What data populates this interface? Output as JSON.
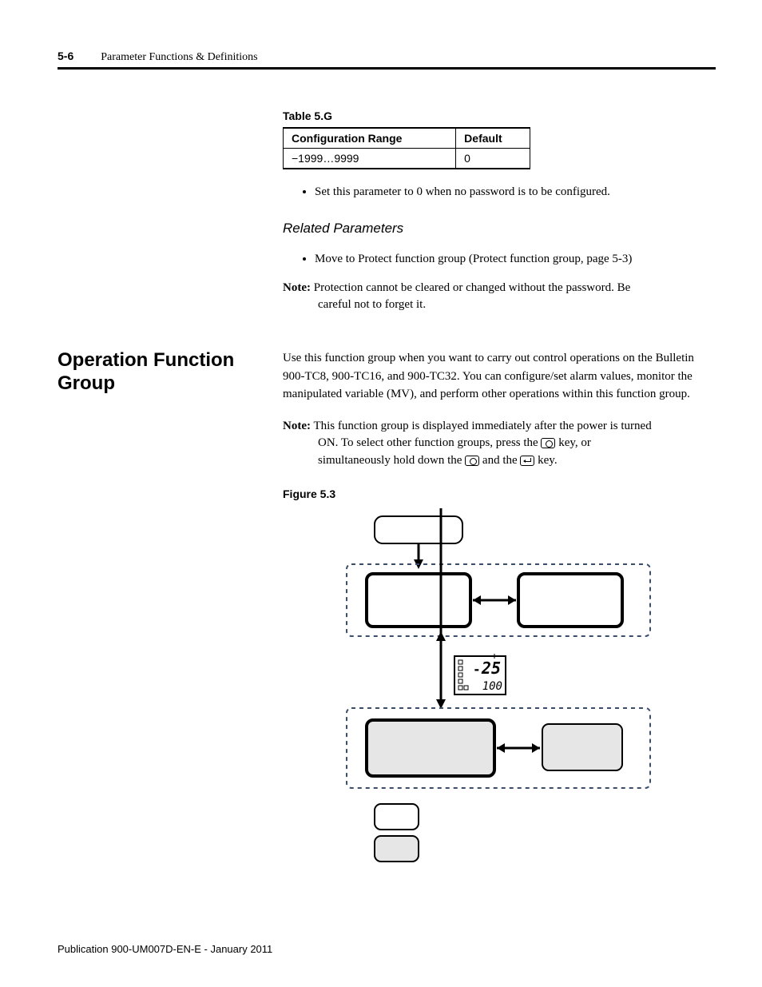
{
  "header": {
    "page_number": "5-6",
    "chapter_title": "Parameter Functions & Definitions"
  },
  "table": {
    "label": "Table 5.G",
    "headers": {
      "col1": "Configuration Range",
      "col2": "Default"
    },
    "row": {
      "range": "−1999…9999",
      "default": "0"
    }
  },
  "bullets_after_table": [
    "Set this parameter to 0 when no password is to be configured."
  ],
  "related": {
    "heading": "Related Parameters",
    "items": [
      "Move to Protect function group (Protect function group, page 5-3)"
    ]
  },
  "note1": {
    "label": "Note:",
    "line1": "Protection cannot be cleared or changed without the password. Be",
    "line2": "careful not to forget it."
  },
  "section": {
    "heading": "Operation Function Group",
    "para1": "Use this function group when you want to carry out control operations on the Bulletin 900-TC8, 900-TC16, and 900-TC32. You can configure/set alarm values, monitor the manipulated variable (MV), and perform other operations within this function group."
  },
  "note2": {
    "label": "Note:",
    "parts": {
      "a": "This function group is displayed immediately after the power is turned",
      "b": "ON. To select other function groups, press the ",
      "c": " key, or",
      "d": "simultaneously hold down the ",
      "e": " and the ",
      "f": " key."
    }
  },
  "figure": {
    "label": "Figure 5.3",
    "display": {
      "top": "25",
      "bottom": "100"
    }
  },
  "footer": "Publication 900-UM007D-EN-E - January 2011"
}
